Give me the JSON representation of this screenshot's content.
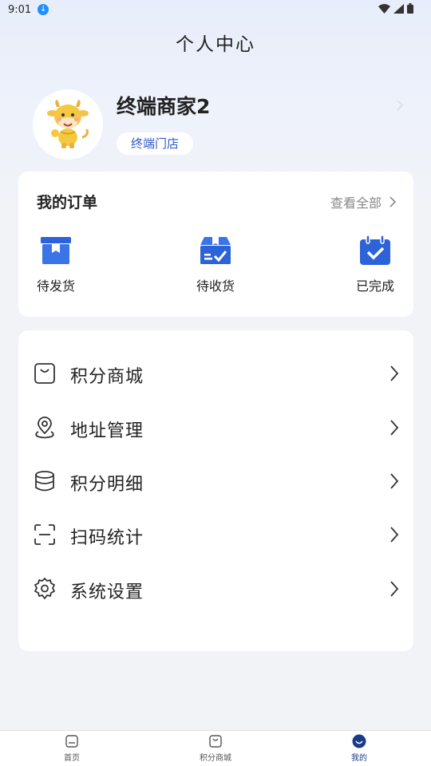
{
  "status_bar": {
    "time": "9:01"
  },
  "header": {
    "title": "个人中心"
  },
  "profile": {
    "name": "终端商家2",
    "store_badge": "终端门店"
  },
  "orders": {
    "title": "我的订单",
    "view_all": "查看全部",
    "items": [
      {
        "label": "待发货",
        "icon": "box-icon"
      },
      {
        "label": "待收货",
        "icon": "delivery-box-icon"
      },
      {
        "label": "已完成",
        "icon": "calendar-check-icon"
      }
    ]
  },
  "menu": {
    "items": [
      {
        "label": "积分商城",
        "icon": "shopping-bag-icon"
      },
      {
        "label": "地址管理",
        "icon": "location-pin-icon"
      },
      {
        "label": "积分明细",
        "icon": "database-icon"
      },
      {
        "label": "扫码统计",
        "icon": "scan-icon"
      },
      {
        "label": "系统设置",
        "icon": "gear-icon"
      }
    ]
  },
  "bottom_nav": {
    "items": [
      {
        "label": "首页",
        "icon": "home-icon",
        "active": false
      },
      {
        "label": "积分商城",
        "icon": "shopping-bag-icon",
        "active": false
      },
      {
        "label": "我的",
        "icon": "smile-icon",
        "active": true
      }
    ]
  },
  "colors": {
    "accent": "#2f5ac8",
    "icon_blue": "#2d63d8",
    "nav_active": "#1a3a8a"
  }
}
